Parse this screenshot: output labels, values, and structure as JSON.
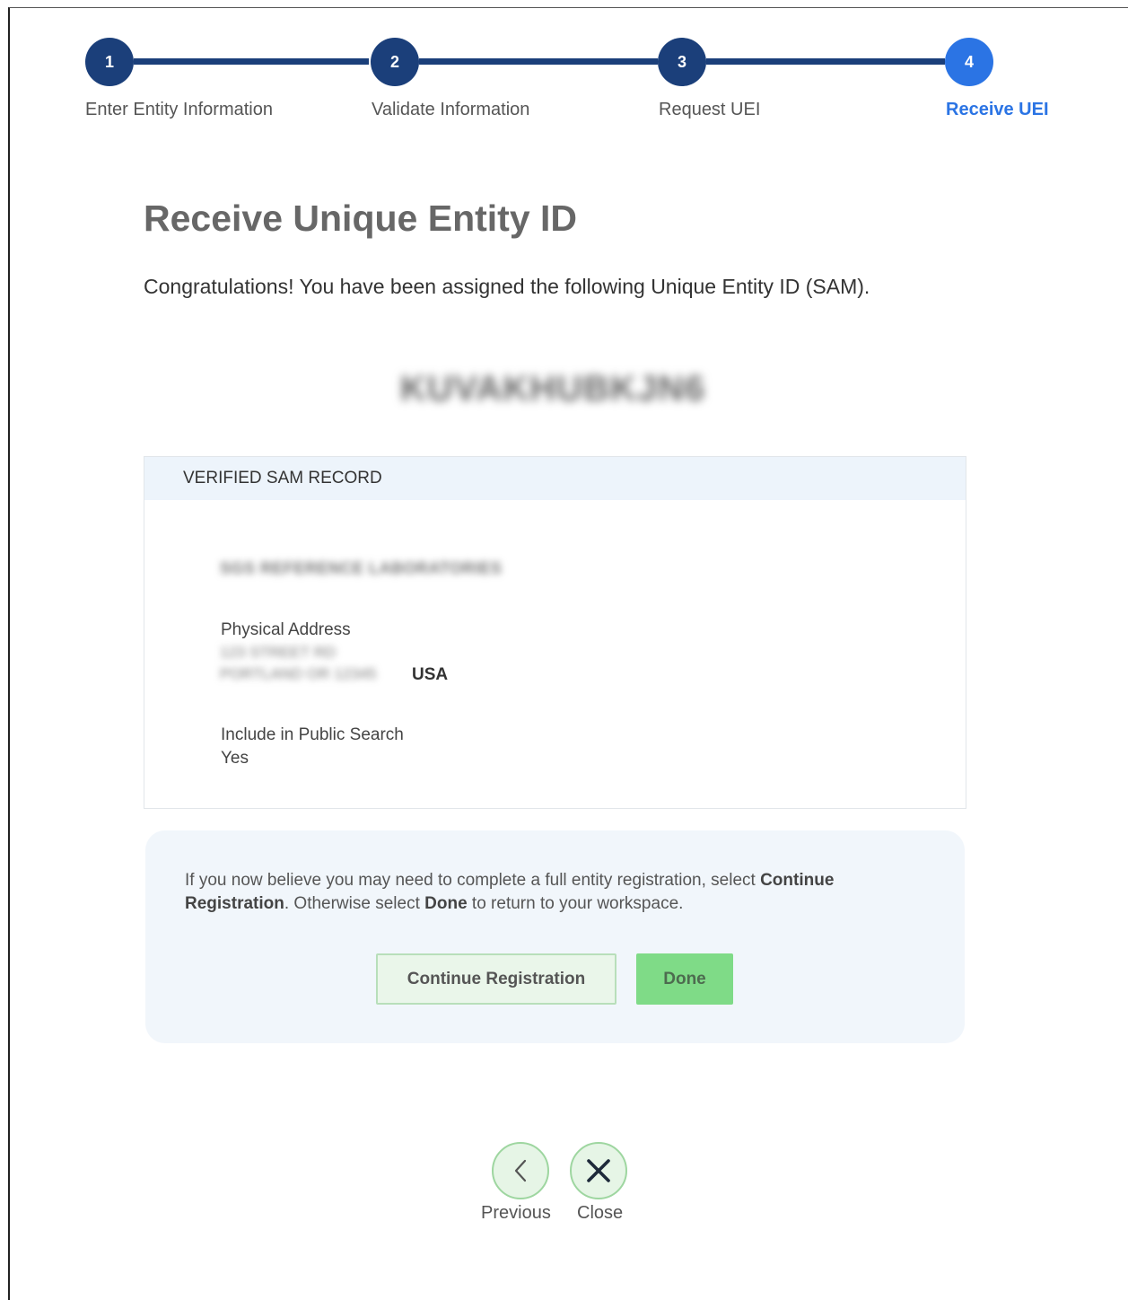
{
  "stepper": {
    "steps": [
      {
        "number": "1",
        "label": "Enter Entity Information"
      },
      {
        "number": "2",
        "label": "Validate Information"
      },
      {
        "number": "3",
        "label": "Request UEI"
      },
      {
        "number": "4",
        "label": "Receive UEI"
      }
    ],
    "active_step": 4,
    "colors": {
      "completed": "#1b3f7a",
      "active": "#2b74e4"
    }
  },
  "main": {
    "title": "Receive Unique Entity ID",
    "congrats_message": "Congratulations! You have been assigned the following Unique Entity ID (SAM).",
    "uei_value": "KUVAKHUBKJN6"
  },
  "record": {
    "header": "VERIFIED SAM RECORD",
    "entity_name": "SGS REFERENCE LABORATORIES",
    "physical_address_label": "Physical Address",
    "address_line1": "123 STREET RD",
    "address_line2": "PORTLAND OR 12345",
    "address_country": "USA",
    "public_search_label": "Include in Public Search",
    "public_search_value": "Yes"
  },
  "info": {
    "text_part1": "If you now believe you may need to complete a full entity registration, select ",
    "continue_bold": "Continue Registration",
    "text_part2": ". Otherwise select ",
    "done_bold": "Done",
    "text_part3": " to return to your workspace.",
    "continue_button_label": "Continue Registration",
    "done_button_label": "Done"
  },
  "nav": {
    "previous_label": "Previous",
    "close_label": "Close",
    "previous_icon": "chevron-left-icon",
    "close_icon": "close-icon"
  }
}
